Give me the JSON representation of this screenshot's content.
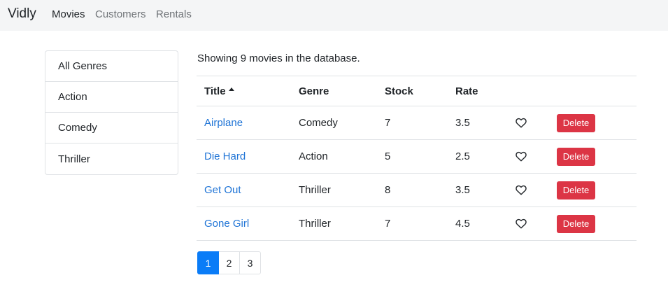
{
  "navbar": {
    "brand": "Vidly",
    "links": [
      {
        "label": "Movies",
        "active": true
      },
      {
        "label": "Customers",
        "active": false
      },
      {
        "label": "Rentals",
        "active": false
      }
    ]
  },
  "genres": {
    "items": [
      "All Genres",
      "Action",
      "Comedy",
      "Thriller"
    ]
  },
  "summary": {
    "text": "Showing 9 movies in the database."
  },
  "table": {
    "columns": {
      "title": "Title",
      "genre": "Genre",
      "stock": "Stock",
      "rate": "Rate"
    },
    "sort": {
      "column": "Title",
      "direction": "asc",
      "icon": "sort-up-icon"
    },
    "rows": [
      {
        "title": "Airplane",
        "genre": "Comedy",
        "stock": "7",
        "rate": "3.5",
        "liked": false,
        "delete_label": "Delete"
      },
      {
        "title": "Die Hard",
        "genre": "Action",
        "stock": "5",
        "rate": "2.5",
        "liked": false,
        "delete_label": "Delete"
      },
      {
        "title": "Get Out",
        "genre": "Thriller",
        "stock": "8",
        "rate": "3.5",
        "liked": false,
        "delete_label": "Delete"
      },
      {
        "title": "Gone Girl",
        "genre": "Thriller",
        "stock": "7",
        "rate": "4.5",
        "liked": false,
        "delete_label": "Delete"
      }
    ]
  },
  "pagination": {
    "pages": [
      "1",
      "2",
      "3"
    ],
    "current": "1"
  },
  "colors": {
    "link": "#1f74d6",
    "danger": "#dc3545",
    "primary": "#0a7cf7",
    "navbar_bg": "#f4f5f6"
  }
}
